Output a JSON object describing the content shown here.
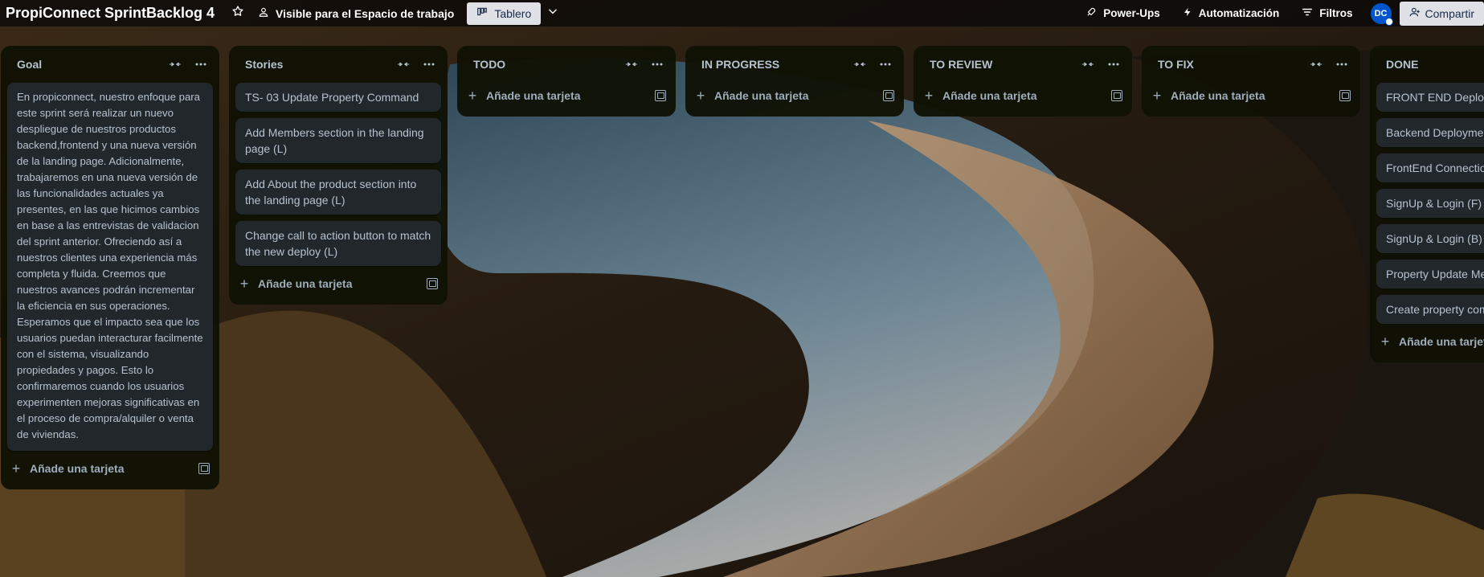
{
  "topbar": {
    "title": "PropiConnect SprintBacklog 4",
    "visibility_label": "Visible para el Espacio de trabajo",
    "view_label": "Tablero",
    "powerups_label": "Power-Ups",
    "automation_label": "Automatización",
    "filters_label": "Filtros",
    "avatar_initials": "DC",
    "share_label": "Compartir"
  },
  "add_card_label": "Añade una tarjeta",
  "lists": [
    {
      "title": "Goal",
      "cards": [
        "En propiconnect, nuestro enfoque para este sprint será realizar un nuevo despliegue de nuestros productos backend,frontend y una nueva versión de la landing page. Adicionalmente, trabajaremos en una nueva versión de las funcionalidades actuales ya presentes, en las que hicimos cambios en base a las entrevistas de validacion del sprint anterior. Ofreciendo así a nuestros clientes una experiencia más completa y fluida. Creemos que nuestros avances podrán incrementar la eficiencia en sus operaciones. Esperamos que el impacto sea que los usuarios puedan interacturar facilmente con el sistema, visualizando propiedades y pagos. Esto lo confirmaremos cuando los usuarios experimenten mejoras significativas en el proceso de compra/alquiler o venta de viviendas."
      ]
    },
    {
      "title": "Stories",
      "cards": [
        "TS- 03 Update Property Command",
        "Add Members section in the landing page (L)",
        "Add About the product section into the landing page (L)",
        "Change call to action button to match the new deploy (L)"
      ]
    },
    {
      "title": "TODO",
      "cards": []
    },
    {
      "title": "IN PROGRESS",
      "cards": []
    },
    {
      "title": "TO REVIEW",
      "cards": []
    },
    {
      "title": "TO FIX",
      "cards": []
    },
    {
      "title": "DONE",
      "cards": [
        "FRONT END Deployment",
        "Backend Deployment",
        "FrontEnd Connection",
        "SignUp & Login (F)",
        "SignUp & Login (B)",
        "Property Update Method",
        "Create property component"
      ]
    }
  ],
  "colors": {
    "topbar_bg": "#0c0a08",
    "list_bg": "#101204",
    "card_bg": "#22272b",
    "text": "#b6c2cf",
    "avatar_bg": "#0055cc",
    "button_light": "#dfe1e6"
  }
}
